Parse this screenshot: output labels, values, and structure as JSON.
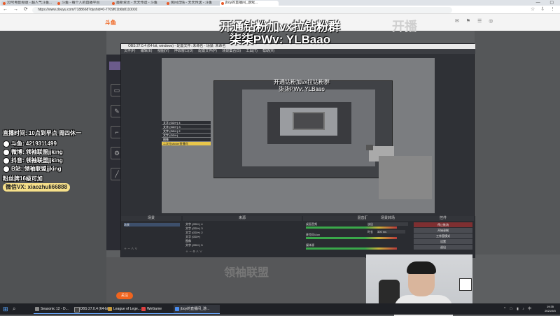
{
  "browser": {
    "tabs": [
      {
        "label": "33号电影频道 - 超人气斗鱼..."
      },
      {
        "label": "斗鱼 - 每个人的直播平台"
      },
      {
        "label": "最新资讯 - 天天传送 - 斗鱼"
      },
      {
        "label": "房间详情 - 天天传送 - 斗鱼"
      },
      {
        "label": "jboy的直播间_游戏..."
      }
    ],
    "window_controls": "— ▢ ✕",
    "nav_icons": "← → ⟳",
    "url": "https://www.douyu.com/7188668?dyshid=0-7709f01b6b8110002",
    "toolbar_icons": "☆ ⇩ ⋮"
  },
  "site": {
    "logo": "斗鱼",
    "header_deco": "开播",
    "header_icons": "✉ ⚑ ☰ ◎"
  },
  "overlay": {
    "line1": "开通钻粉加vx拉钻粉群",
    "line2": "柒柒PWv: YLBaao"
  },
  "sticker": {
    "title": "直播时间: 10点到早点 周四休一",
    "items": [
      {
        "label": "斗鱼: 4219311499"
      },
      {
        "label": "微博: 领袖联盟jjking"
      },
      {
        "label": "抖音: 领袖联盟jjking"
      },
      {
        "label": "B站: 领袖联盟jjking"
      }
    ],
    "group": "粉丝牌16级可加",
    "wechat": "微信VX: xiaozhuli66888"
  },
  "obs": {
    "title": "OBS 27.0.4 (64-bit, windows) - 配置文件: 未命名 - 场景: 未命名",
    "menu": [
      "文件(F)",
      "编辑(E)",
      "视图(V)",
      "停靠窗口(D)",
      "配置文件(P)",
      "场景集合(S)",
      "工具(T)",
      "帮助(H)"
    ],
    "nested_list": [
      {
        "label": "文字 (GDI+) 4"
      },
      {
        "label": "文字 (GDI+) 3"
      },
      {
        "label": "文字 (GDI+) 2"
      },
      {
        "label": "文字 (GDI+)"
      },
      {
        "label": "图像"
      },
      {
        "label": "二次元sticker直播间"
      }
    ],
    "docks": {
      "scenes_header": "场景",
      "scene_item": "场景",
      "sources_header": "来源",
      "sources": [
        {
          "label": "文字 (GDI+) 4"
        },
        {
          "label": "文字 (GDI+) 3"
        },
        {
          "label": "文字 (GDI+) 2"
        },
        {
          "label": "文字 (GDI+)"
        },
        {
          "label": "图像"
        },
        {
          "label": "文字 (GDI+) 5"
        }
      ],
      "mixer_header": "混音器",
      "mixer": [
        {
          "label": "桌面音频"
        },
        {
          "label": "麦克风/Aux"
        },
        {
          "label": "媒体源"
        }
      ],
      "transitions_header": "场景转场",
      "transition_value": "淡出",
      "duration_label": "时长",
      "duration_value": "300 ms",
      "controls_header": "控件",
      "controls": [
        {
          "label": "停止推流",
          "red": true
        },
        {
          "label": "开始录制",
          "red": false
        },
        {
          "label": "工作室模式",
          "red": false
        },
        {
          "label": "设置",
          "red": false
        },
        {
          "label": "退出",
          "red": false
        }
      ]
    }
  },
  "page_bottom": {
    "deco": "领袖联盟",
    "orange_button": "关注"
  },
  "taskbar": {
    "start_icon": "⊞",
    "search_icon": "⌕",
    "apps": [
      {
        "label": "Seasonic 12 - D...",
        "color": "#8a8a8a"
      },
      {
        "label": "OBS 27.0.4 (64-bit)",
        "color": "#444"
      },
      {
        "label": "League of Lege...",
        "color": "#c89b3c"
      },
      {
        "label": "WeGame",
        "color": "#e04040"
      },
      {
        "label": "jboy的直播间_游...",
        "color": "#4a8df0"
      }
    ],
    "tray": "^ ☁ ▮ ♪ 中",
    "time": "19:35",
    "date": "2021/9/3"
  }
}
